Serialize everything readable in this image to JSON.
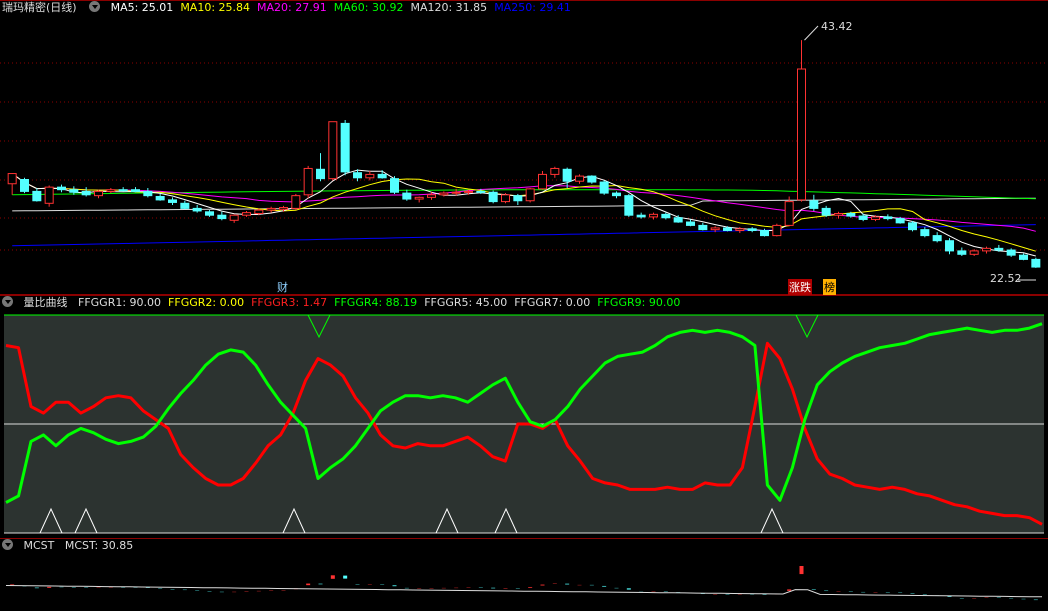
{
  "main": {
    "title": "瑞玛精密(日线)",
    "ma": [
      {
        "label": "MA5: 25.01",
        "color": "#ffffff"
      },
      {
        "label": "MA10: 25.84",
        "color": "#ffff00"
      },
      {
        "label": "MA20: 27.91",
        "color": "#ff00ff"
      },
      {
        "label": "MA60: 30.92",
        "color": "#00ff00"
      },
      {
        "label": "MA120: 31.85",
        "color": "#dddddd"
      },
      {
        "label": "MA250: 29.41",
        "color": "#0000ff"
      }
    ],
    "high_label": "43.42",
    "low_label": "22.52",
    "tag_cai": "财",
    "tag_zhangdie": "涨跌",
    "tag_bang": "榜"
  },
  "indicator": {
    "title": "量比曲线",
    "items": [
      {
        "label": "FFGGR1: 90.00",
        "color": "#dddddd"
      },
      {
        "label": "FFGGR2: 0.00",
        "color": "#ffff00"
      },
      {
        "label": "FFGGR3: 1.47",
        "color": "#ff2020"
      },
      {
        "label": "FFGGR4: 88.19",
        "color": "#00ff00"
      },
      {
        "label": "FFGGR5: 45.00",
        "color": "#dddddd"
      },
      {
        "label": "FFGGR7: 0.00",
        "color": "#dddddd"
      },
      {
        "label": "FFGGR9: 90.00",
        "color": "#00ff00"
      }
    ]
  },
  "mcst": {
    "title": "MCST",
    "value_label": "MCST: 30.85"
  },
  "colors": {
    "up": "#ff3232",
    "down": "#54ffff",
    "grid": "#8b0000",
    "green": "#00ff00",
    "red": "#ff0000",
    "bg_ind": "#2c3330"
  },
  "chart_data": [
    {
      "type": "candlestick",
      "title": "瑞玛精密(日线)",
      "ylim": [
        21,
        44
      ],
      "annotations": [
        "43.42",
        "22.52"
      ],
      "series": [
        {
          "name": "candles",
          "values": [
            [
              26.5,
              27.7,
              25.2,
              27.7
            ],
            [
              27.0,
              27.2,
              25.4,
              25.6
            ],
            [
              25.6,
              26.0,
              24.4,
              24.5
            ],
            [
              24.2,
              26.3,
              23.8,
              26.1
            ],
            [
              26.1,
              26.4,
              25.5,
              25.8
            ],
            [
              25.8,
              26.2,
              25.2,
              25.5
            ],
            [
              25.6,
              26.1,
              25.0,
              25.2
            ],
            [
              25.1,
              25.8,
              24.8,
              25.6
            ],
            [
              25.6,
              26.0,
              25.4,
              25.8
            ],
            [
              25.8,
              26.1,
              25.6,
              25.7
            ],
            [
              25.8,
              26.1,
              25.5,
              25.6
            ],
            [
              25.6,
              26.0,
              24.9,
              25.1
            ],
            [
              25.0,
              25.3,
              24.5,
              24.6
            ],
            [
              24.6,
              24.9,
              24.0,
              24.3
            ],
            [
              24.2,
              24.5,
              23.5,
              23.6
            ],
            [
              23.6,
              24.0,
              23.1,
              23.3
            ],
            [
              23.2,
              23.4,
              22.6,
              22.8
            ],
            [
              22.8,
              23.2,
              22.2,
              22.4
            ],
            [
              22.2,
              22.9,
              21.9,
              22.8
            ],
            [
              22.8,
              23.3,
              22.6,
              23.1
            ],
            [
              23.0,
              23.6,
              22.8,
              23.4
            ],
            [
              23.4,
              23.8,
              23.1,
              23.6
            ],
            [
              23.5,
              23.9,
              23.2,
              23.7
            ],
            [
              23.6,
              25.3,
              23.4,
              25.1
            ],
            [
              25.2,
              28.6,
              24.8,
              28.3
            ],
            [
              28.2,
              30.1,
              26.8,
              27.1
            ],
            [
              27.1,
              33.8,
              26.9,
              33.8
            ],
            [
              33.6,
              34.0,
              27.5,
              27.9
            ],
            [
              27.8,
              28.2,
              26.8,
              27.2
            ],
            [
              27.2,
              28.0,
              26.9,
              27.6
            ],
            [
              27.6,
              28.1,
              27.1,
              27.2
            ],
            [
              27.1,
              27.4,
              25.3,
              25.5
            ],
            [
              25.4,
              25.8,
              24.5,
              24.7
            ],
            [
              24.7,
              25.0,
              24.3,
              24.9
            ],
            [
              24.9,
              25.5,
              24.6,
              25.2
            ],
            [
              25.2,
              25.6,
              25.0,
              25.4
            ],
            [
              25.4,
              25.9,
              25.1,
              25.5
            ],
            [
              25.5,
              25.8,
              25.2,
              25.6
            ],
            [
              25.6,
              25.9,
              25.3,
              25.5
            ],
            [
              25.5,
              25.7,
              24.2,
              24.4
            ],
            [
              24.4,
              25.4,
              24.2,
              25.2
            ],
            [
              25.1,
              25.3,
              24.0,
              24.5
            ],
            [
              24.5,
              26.0,
              24.3,
              25.9
            ],
            [
              25.9,
              28.0,
              25.8,
              27.6
            ],
            [
              27.6,
              28.5,
              27.2,
              28.3
            ],
            [
              28.2,
              28.4,
              26.0,
              26.8
            ],
            [
              26.8,
              27.6,
              26.5,
              27.4
            ],
            [
              27.4,
              27.5,
              26.5,
              26.7
            ],
            [
              26.7,
              26.9,
              25.2,
              25.4
            ],
            [
              25.4,
              25.6,
              24.8,
              25.1
            ],
            [
              25.1,
              25.3,
              22.6,
              22.8
            ],
            [
              22.8,
              23.1,
              22.4,
              22.6
            ],
            [
              22.6,
              23.1,
              22.3,
              22.9
            ],
            [
              22.9,
              23.1,
              22.3,
              22.5
            ],
            [
              22.5,
              22.8,
              21.9,
              22.0
            ],
            [
              22.0,
              22.3,
              21.5,
              21.6
            ],
            [
              21.6,
              21.9,
              21.0,
              21.1
            ],
            [
              21.1,
              21.5,
              20.8,
              21.3
            ],
            [
              21.3,
              21.5,
              20.9,
              21.0
            ],
            [
              21.0,
              21.4,
              20.7,
              21.2
            ],
            [
              21.2,
              21.4,
              20.8,
              21.0
            ],
            [
              21.0,
              21.2,
              20.3,
              20.4
            ],
            [
              20.4,
              21.8,
              20.3,
              21.6
            ],
            [
              21.6,
              25.0,
              21.5,
              24.4
            ],
            [
              24.6,
              43.4,
              24.4,
              40.0
            ],
            [
              24.5,
              25.2,
              23.3,
              23.6
            ],
            [
              23.6,
              23.9,
              22.6,
              22.8
            ],
            [
              22.8,
              23.2,
              22.4,
              23.0
            ],
            [
              23.0,
              23.2,
              22.5,
              22.7
            ],
            [
              22.7,
              23.0,
              22.1,
              22.3
            ],
            [
              22.3,
              22.8,
              22.1,
              22.6
            ],
            [
              22.6,
              22.9,
              22.2,
              22.4
            ],
            [
              22.4,
              22.6,
              21.8,
              21.9
            ],
            [
              21.9,
              22.1,
              20.9,
              21.1
            ],
            [
              21.1,
              21.4,
              20.2,
              20.4
            ],
            [
              20.4,
              20.8,
              19.6,
              19.8
            ],
            [
              19.8,
              20.1,
              18.2,
              18.6
            ],
            [
              18.6,
              19.0,
              18.0,
              18.2
            ],
            [
              18.2,
              18.8,
              18.0,
              18.6
            ],
            [
              18.6,
              19.1,
              18.3,
              18.9
            ],
            [
              18.9,
              19.3,
              18.5,
              18.7
            ],
            [
              18.7,
              18.9,
              17.9,
              18.1
            ],
            [
              18.1,
              18.3,
              17.5,
              17.6
            ],
            [
              17.6,
              17.8,
              16.6,
              16.7
            ]
          ]
        }
      ]
    },
    {
      "type": "line",
      "title": "量比曲线",
      "ylim": [
        0,
        100
      ],
      "series": [
        {
          "name": "FFGGR3",
          "values": [
            86,
            85,
            58,
            55,
            60,
            60,
            55,
            58,
            62,
            63,
            62,
            56,
            52,
            48,
            36,
            30,
            25,
            22,
            22,
            25,
            32,
            40,
            45,
            55,
            70,
            80,
            77,
            72,
            62,
            55,
            45,
            40,
            39,
            41,
            40,
            40,
            42,
            44,
            40,
            35,
            33,
            50,
            50,
            48,
            52,
            40,
            33,
            25,
            23,
            22,
            20,
            20,
            20,
            21,
            20,
            20,
            23,
            22,
            22,
            30,
            58,
            87,
            80,
            66,
            48,
            34,
            27,
            25,
            22,
            21,
            20,
            21,
            20,
            18,
            17,
            15,
            13,
            12,
            10,
            9,
            8,
            8,
            7,
            4
          ]
        },
        {
          "name": "FFGGR4",
          "values": [
            14,
            17,
            42,
            45,
            40,
            45,
            48,
            46,
            43,
            41,
            42,
            44,
            49,
            57,
            64,
            70,
            77,
            82,
            84,
            83,
            77,
            68,
            60,
            54,
            48,
            25,
            30,
            34,
            40,
            48,
            56,
            60,
            63,
            63,
            62,
            63,
            62,
            60,
            64,
            68,
            71,
            60,
            51,
            49,
            52,
            58,
            66,
            72,
            78,
            81,
            82,
            83,
            86,
            90,
            92,
            93,
            92,
            93,
            92,
            90,
            86,
            22,
            15,
            30,
            52,
            68,
            74,
            78,
            81,
            83,
            85,
            86,
            87,
            89,
            91,
            92,
            93,
            94,
            93,
            92,
            93,
            93,
            94,
            96
          ]
        }
      ]
    },
    {
      "type": "line",
      "title": "MCST",
      "series": [
        {
          "name": "MCST",
          "values": [
            30.85
          ]
        }
      ]
    }
  ]
}
